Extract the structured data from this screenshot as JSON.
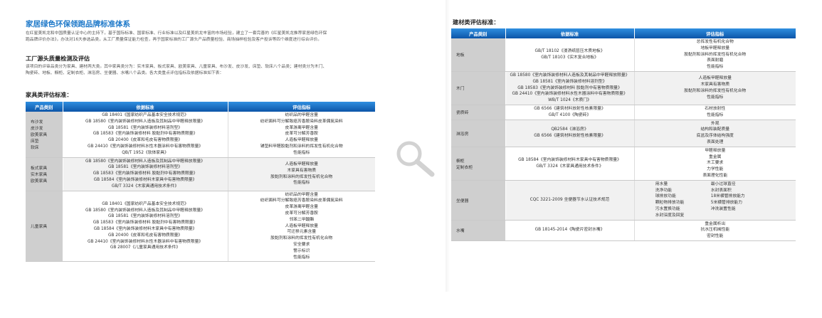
{
  "left": {
    "title": "家居绿色环保领跑品牌标准体系",
    "intro": [
      "在红星美凯龙和中国质量认证中心的主持下，基于国际标准、国家标准、行业标准以及红星美凯龙丰富的市场经验，建立了一套完善的《红星美凯龙推荐家居绿色环保",
      "跑品牌评价办法》，办法对16大参选品类，从工厂质量保证能力检查，再于国家标准的工厂源头产品质量检验、商场抽样检验及客户投诉等四个维度进行综合评价。"
    ],
    "section_heading": "工厂源头质量检测及评估",
    "section_text": [
      "该项目的评审品类分为家具、建材两大类。其中家具类分为：实木家具、板式家具、欧美家具、儿童家具、布沙发、皮沙发、床垫、软床八个品类；建材类分为木门、",
      "陶瓷砖、地板、橱柜、定制衣柜、淋浴房、坐便器、水嘴八个品类。各大类重点评估指标及依据标准如下表："
    ],
    "table_heading": "家具类评估标准：",
    "table": {
      "headers": [
        "产品类别",
        "依据标准",
        "评估指标"
      ],
      "rows": [
        {
          "category": [
            "布沙发",
            "皮沙发",
            "欧美家具",
            "床垫",
            "软床"
          ],
          "standards": [
            "GB 18401《国家纺织产品基本安全技术规范》",
            "GB 18580《室内装饰装修材料人造板及其制品中甲醛释放限量》",
            "GB 18581《室内装饰装修材料溶剂型》",
            "GB 18583《室内装饰装修材料 胶黏剂中有害物质限量》",
            "GB 20400《皮革和毛皮有害物质限量》",
            "GB 24410《室内装饰装修材料水性木器涂料中有害物质限量》",
            "QB/T 1952《软体家具》"
          ],
          "indicators": [
            "纺织品的甲醛含量",
            "纺织面料可分解致癌芳香胺染料皮革偶氮染料",
            "皮革游离甲醛含量",
            "皮革可分解芳香胺",
            "人造板甲醛释放量",
            "铺垫料甲醛胶黏剂和涂料的挥发性有机化合物",
            "性能指标"
          ]
        },
        {
          "category": [
            "板式家具",
            "实木家具",
            "欧美家具"
          ],
          "standards": [
            "GB 18580《室内装饰装修材料人造板及其制品中甲醛释放限量》",
            "GB 18581《室内装饰装修材料溶剂型》",
            "GB 18583《室内装饰装修材料 胶黏剂中有害物质限量》",
            "GB 18584《室内装饰装修材料木家具中有害物质限量》",
            "GB/T 3324《木家具通用技术条件》"
          ],
          "indicators": [
            "人造板甲醛释放量",
            "木家具有害物质",
            "胶黏剂和涂料的挥发性有机化合物",
            "性能指标"
          ]
        },
        {
          "category": [
            "儿童家具"
          ],
          "standards": [
            "GB 18401《国家纺织产品基本安全技术规范》",
            "GB 18580《室内装饰装修材料人造板及其制品中甲醛释放限量》",
            "GB 18581《室内装饰装修材料溶剂型》",
            "GB 18583《室内装饰装修材料 胶黏剂中有害物质限量》",
            "GB 18584《室内装饰装修材料木家具中有害物质限量》",
            "GB 20400《皮革和毛皮有害物质限量》",
            "GB 24410《室内装饰装修材料水性木器涂料中有害物质限量》",
            "GB 28007《儿童家具通用技术条件》"
          ],
          "indicators": [
            "纺织品的甲醛含量",
            "纺织面料可分解致癌芳香胺染料皮革偶氮染料",
            "皮革游离甲醛含量",
            "皮革可分解芳香胺",
            "邻苯二甲酸酯",
            "人造板甲醛释放量",
            "可迁移元素含量",
            "胶黏剂和涂料的挥发性有机化合物",
            "安全要求",
            "警示标识",
            "性能指标"
          ]
        }
      ]
    }
  },
  "right": {
    "table_heading": "建材类评估标准：",
    "table": {
      "headers": [
        "产品类别",
        "依据标准",
        "评估指标"
      ],
      "rows": [
        {
          "category": [
            "地板"
          ],
          "standards": [
            "GB/T 18102《浸渍纸层压木质地板》",
            "GB/T 18103《实木复合地板》"
          ],
          "indicators": [
            "总挥发性有机化合物",
            "地板甲醛释放量",
            "胶黏剂和涂料的挥发性有机化合物",
            "表面耐磨",
            "性能指标"
          ]
        },
        {
          "category": [
            "木门"
          ],
          "standards": [
            "GB 18580《室内装饰装修材料人造板及其制品中甲醛释放限量》",
            "GB 18581《室内装饰装修材料溶剂型》",
            "GB 18583《室内装饰装修材料 胶黏剂中有害物质限量》",
            "GB 24410《室内装饰装修材料水性木器涂料中有害物质限量》",
            "WB/T 1024《木质门》"
          ],
          "indicators": [
            "人造板甲醛释放量",
            "木家具有害物质",
            "胶黏剂和涂料的挥发性有机化合物",
            "性能指标"
          ]
        },
        {
          "category": [
            "瓷质砖"
          ],
          "standards": [
            "GB 6566《建筑材料放射性核素限量》",
            "GB/T 4100《陶瓷砖》"
          ],
          "indicators": [
            "石材放射性",
            "性能指标"
          ]
        },
        {
          "category": [
            "淋浴房"
          ],
          "standards": [
            "QB2584《淋浴房》",
            "GB 6566《建筑材料放射性核素限量》"
          ],
          "indicators": [
            "外观",
            "结构和装配质量",
            "底盆及序体结构强度",
            "表面处理"
          ]
        },
        {
          "category": [
            "橱柜",
            "定制衣柜"
          ],
          "standards": [
            "GB 18584《室内装饰装修材料木家具中有害物质限量》",
            "GB/T 3324《木家具通用技术条件》"
          ],
          "indicators": [
            "甲醛释放量",
            "重金属",
            "木工要求",
            "力学性能",
            "表面理化性能"
          ]
        },
        {
          "category": [
            "坐便器"
          ],
          "standards": [
            "CQC 3221-2009 坐便器节水认证技术规范"
          ],
          "indicators_grid": [
            [
              "用水量",
              "最小过球直径"
            ],
            [
              "洗净功能",
              "水封表面积"
            ],
            [
              "球排放功能",
              "18米横管排放能力"
            ],
            [
              "颗粒物排放功能",
              "5米横管排放能力"
            ],
            [
              "污水置换功能",
              "冲洗装置性能"
            ],
            [
              "水封深度及回复",
              ""
            ]
          ]
        },
        {
          "category": [
            "水嘴"
          ],
          "standards": [
            "GB 18145-2014《陶瓷片密封水嘴》"
          ],
          "indicators": [
            "重金属析出",
            "抗水压机械性能",
            "密封性能"
          ]
        }
      ]
    }
  },
  "zoom_icon": "magnifier-icon",
  "colors": {
    "accent": "#1c78c9",
    "header_top": "#2f8fe0",
    "header_bottom": "#0c55a8",
    "category_bg": "#cfcfcf"
  }
}
